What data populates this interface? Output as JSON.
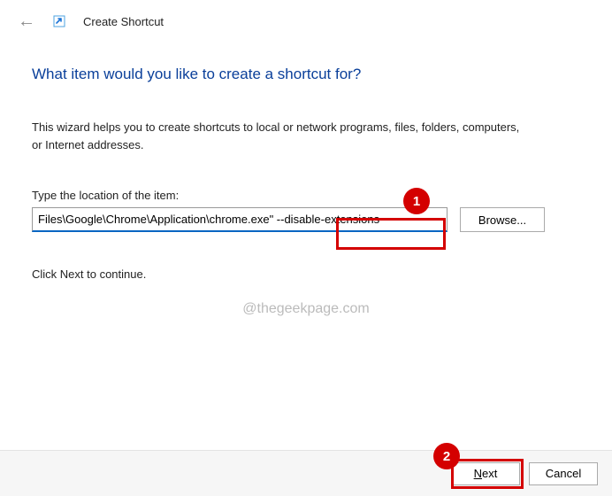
{
  "header": {
    "title": "Create Shortcut"
  },
  "heading": "What item would you like to create a shortcut for?",
  "description": "This wizard helps you to create shortcuts to local or network programs, files, folders, computers, or Internet addresses.",
  "field_label": "Type the location of the item:",
  "path_value": "Files\\Google\\Chrome\\Application\\chrome.exe\" --disable-extensions",
  "browse_label": "Browse...",
  "continue_text": "Click Next to continue.",
  "watermark": "@thegeekpage.com",
  "footer": {
    "next_prefix": "N",
    "next_rest": "ext",
    "cancel": "Cancel"
  },
  "badges": {
    "one": "1",
    "two": "2"
  }
}
